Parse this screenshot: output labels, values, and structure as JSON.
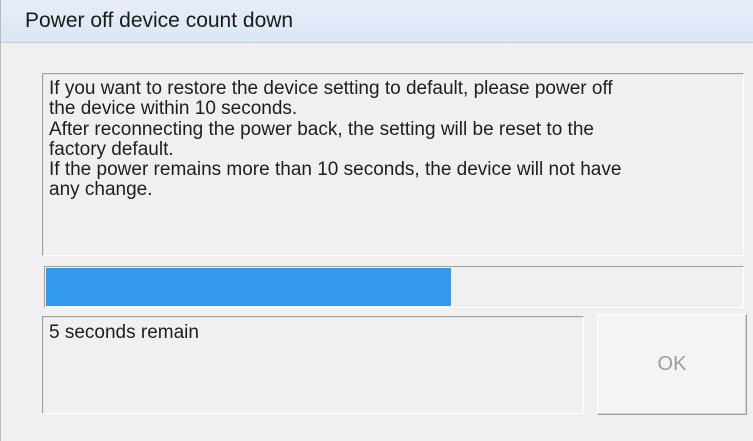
{
  "window": {
    "title": "Power off device count down"
  },
  "message": {
    "lines": [
      "If you want to restore the device setting to default, please power off",
      "the device within 10 seconds.",
      "After reconnecting the power back, the setting will be reset to the",
      "factory default.",
      "If the power remains more than 10 seconds, the device will not have",
      "any change."
    ]
  },
  "progress": {
    "fraction": 0.58,
    "color": "#3399ee"
  },
  "status": {
    "text": "5 seconds remain"
  },
  "buttons": {
    "ok_label": "OK",
    "ok_enabled": false
  }
}
